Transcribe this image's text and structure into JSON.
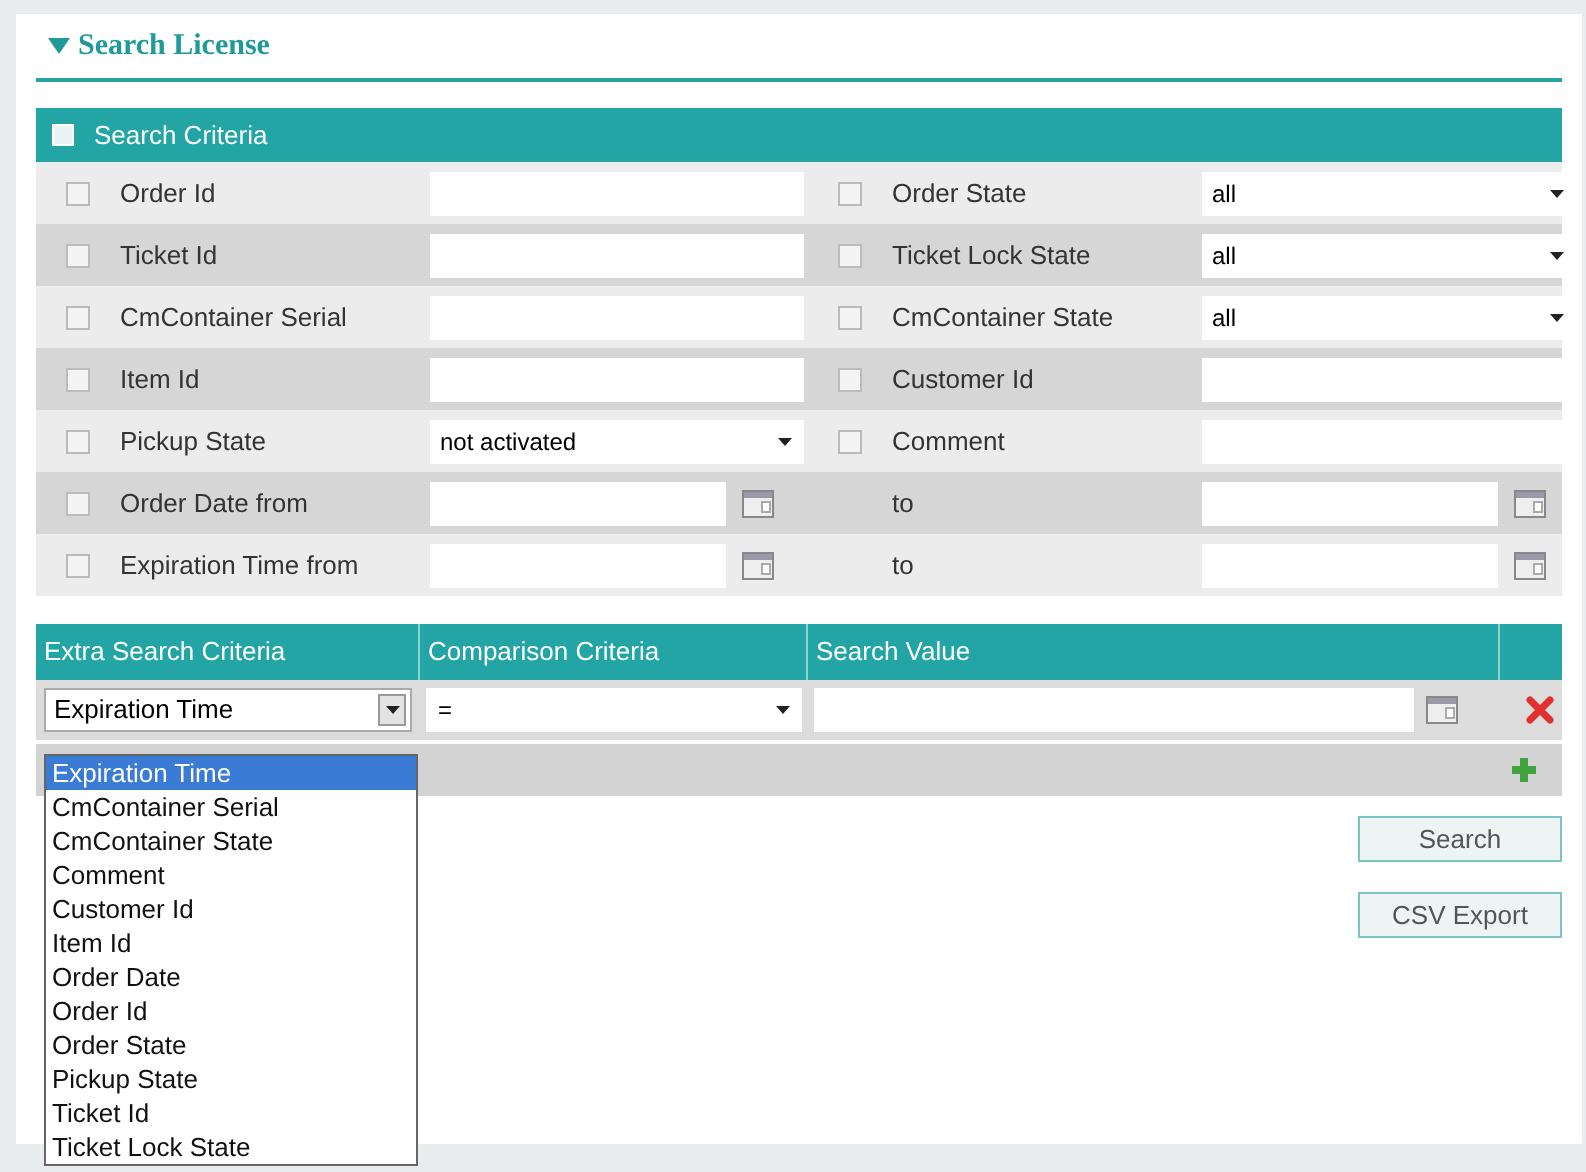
{
  "title": "Search License",
  "criteria": {
    "title": "Search Criteria",
    "checked": false,
    "rows": [
      {
        "left": {
          "checked": false,
          "label": "Order Id",
          "kind": "text"
        },
        "right": {
          "checked": false,
          "label": "Order State",
          "kind": "select",
          "value": "all"
        }
      },
      {
        "left": {
          "checked": false,
          "label": "Ticket Id",
          "kind": "text"
        },
        "right": {
          "checked": false,
          "label": "Ticket Lock State",
          "kind": "select",
          "value": "all"
        }
      },
      {
        "left": {
          "checked": false,
          "label": "CmContainer Serial",
          "kind": "text"
        },
        "right": {
          "checked": false,
          "label": "CmContainer State",
          "kind": "select",
          "value": "all"
        }
      },
      {
        "left": {
          "checked": false,
          "label": "Item Id",
          "kind": "text"
        },
        "right": {
          "checked": false,
          "label": "Customer Id",
          "kind": "text"
        }
      },
      {
        "left": {
          "checked": false,
          "label": "Pickup State",
          "kind": "select",
          "value": "not activated"
        },
        "right": {
          "checked": false,
          "label": "Comment",
          "kind": "text"
        }
      },
      {
        "left": {
          "checked": false,
          "label": "Order Date from",
          "kind": "date"
        },
        "right": {
          "label": "to",
          "kind": "date"
        }
      },
      {
        "left": {
          "checked": false,
          "label": "Expiration Time from",
          "kind": "date"
        },
        "right": {
          "label": "to",
          "kind": "date"
        }
      }
    ]
  },
  "extra": {
    "columns": [
      "Extra Search Criteria",
      "Comparison Criteria",
      "Search Value"
    ],
    "row": {
      "criterion": "Expiration Time",
      "comparison": "="
    },
    "options": [
      {
        "label": "Expiration Time",
        "selected": true
      },
      {
        "label": "CmContainer Serial",
        "selected": false
      },
      {
        "label": "CmContainer State",
        "selected": false
      },
      {
        "label": "Comment",
        "selected": false
      },
      {
        "label": "Customer Id",
        "selected": false
      },
      {
        "label": "Item Id",
        "selected": false
      },
      {
        "label": "Order Date",
        "selected": false
      },
      {
        "label": "Order Id",
        "selected": false
      },
      {
        "label": "Order State",
        "selected": false
      },
      {
        "label": "Pickup State",
        "selected": false
      },
      {
        "label": "Ticket Id",
        "selected": false
      },
      {
        "label": "Ticket Lock State",
        "selected": false
      }
    ]
  },
  "buttons": [
    "Search",
    "CSV Export"
  ]
}
